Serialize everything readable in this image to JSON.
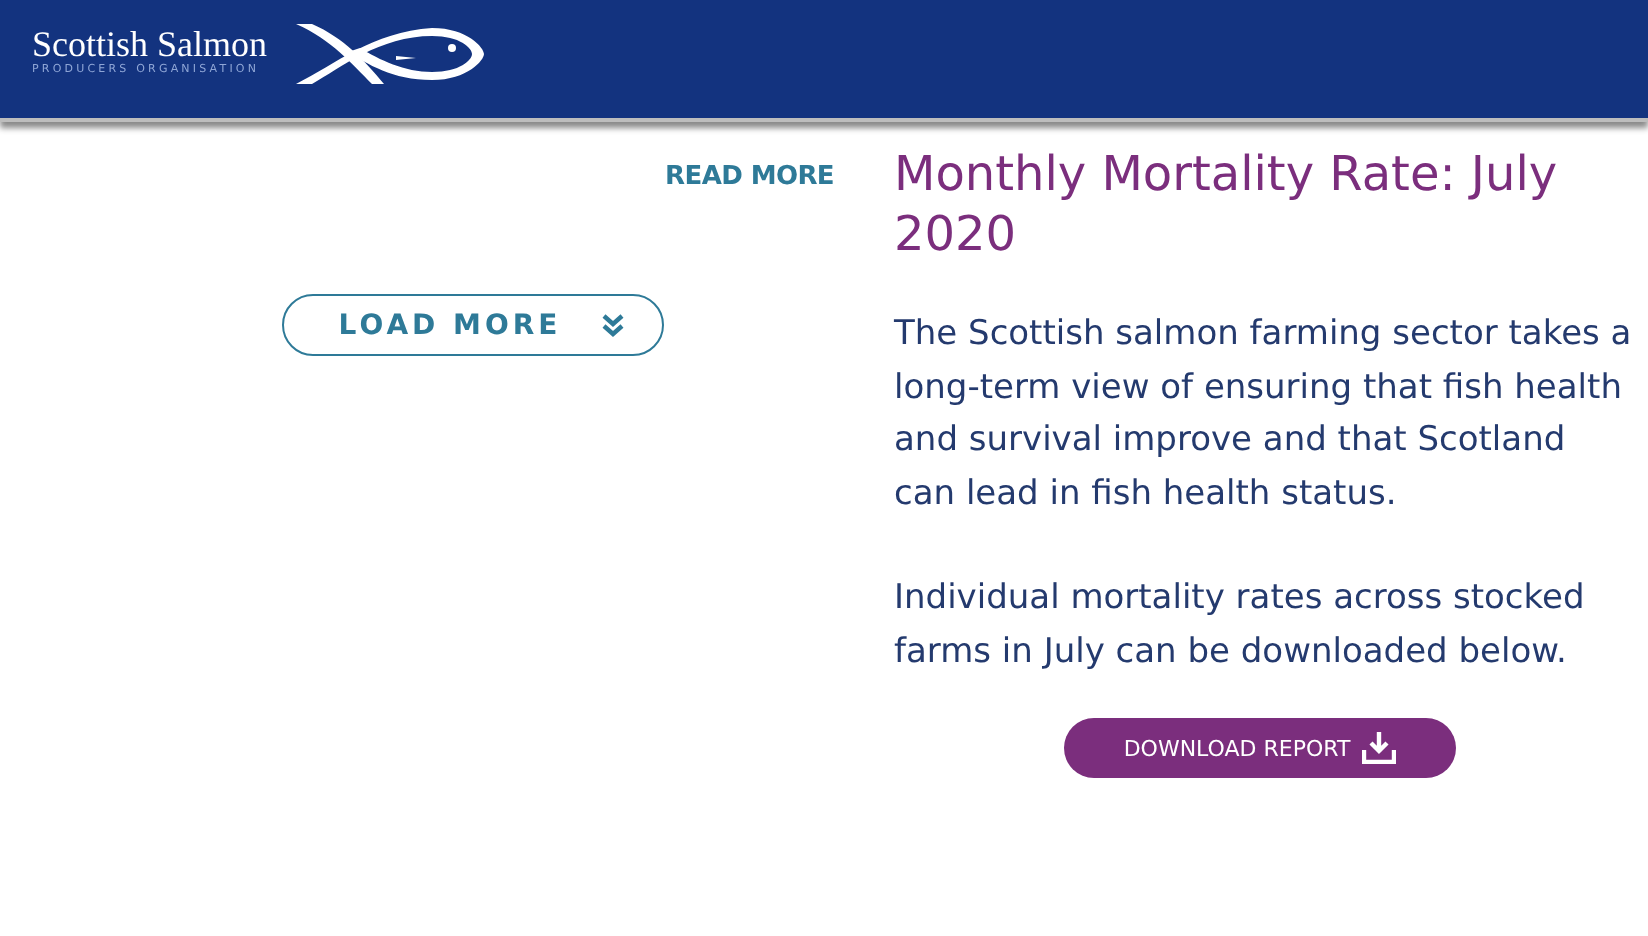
{
  "header": {
    "brand_name": "Scottish Salmon",
    "brand_subtitle": "PRODUCERS ORGANISATION"
  },
  "left": {
    "read_more": "READ MORE",
    "load_more": "LOAD MORE"
  },
  "article": {
    "title": "Monthly Mortality Rate: July 2020",
    "paragraphs": [
      "The Scottish salmon farming sector takes a long-term view of ensuring that fish health and survival improve and that Scotland can lead in fish health status.",
      "Individual mortality rates across stocked farms in July can be downloaded below."
    ],
    "download_button": "DOWNLOAD REPORT"
  }
}
